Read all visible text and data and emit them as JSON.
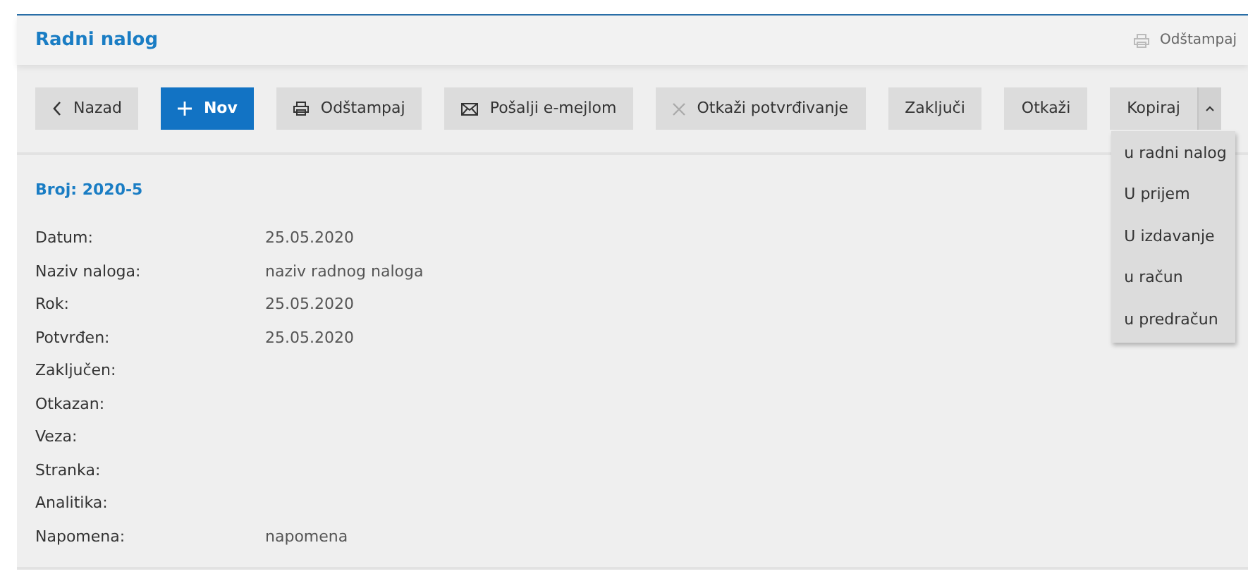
{
  "header": {
    "title": "Radni nalog",
    "print_link": "Odštampaj"
  },
  "toolbar": [
    {
      "label": "Nazad",
      "kind": "back"
    },
    {
      "label": "Nov",
      "kind": "add"
    },
    {
      "label": "Odštampaj",
      "kind": "print"
    },
    {
      "label": "Pošalji e-mejlom",
      "kind": "email"
    },
    {
      "label": "Otkaži potvrđivanje",
      "kind": "cancel"
    },
    {
      "label": "Zaključi",
      "kind": "plain"
    },
    {
      "label": "Otkaži",
      "kind": "plain"
    },
    {
      "label": "Kopiraj",
      "kind": "split",
      "expanded": true
    }
  ],
  "copy_menu": [
    "u radni nalog",
    "U prijem",
    "U izdavanje",
    "u račun",
    "u predračun"
  ],
  "document": {
    "number": "Broj: 2020-5",
    "fields": [
      {
        "label": "Datum:",
        "value": "25.05.2020"
      },
      {
        "label": "Naziv naloga:",
        "value": "naziv radnog naloga"
      },
      {
        "label": "Rok:",
        "value": "25.05.2020"
      },
      {
        "label": "Potvrđen:",
        "value": "25.05.2020"
      },
      {
        "label": "Zaključen:"
      },
      {
        "label": "Otkazan:"
      },
      {
        "label": "Veza:"
      },
      {
        "label": "Stranka:"
      },
      {
        "label": "Analitika:"
      },
      {
        "label": "Napomena:",
        "value": "napomena"
      }
    ]
  }
}
